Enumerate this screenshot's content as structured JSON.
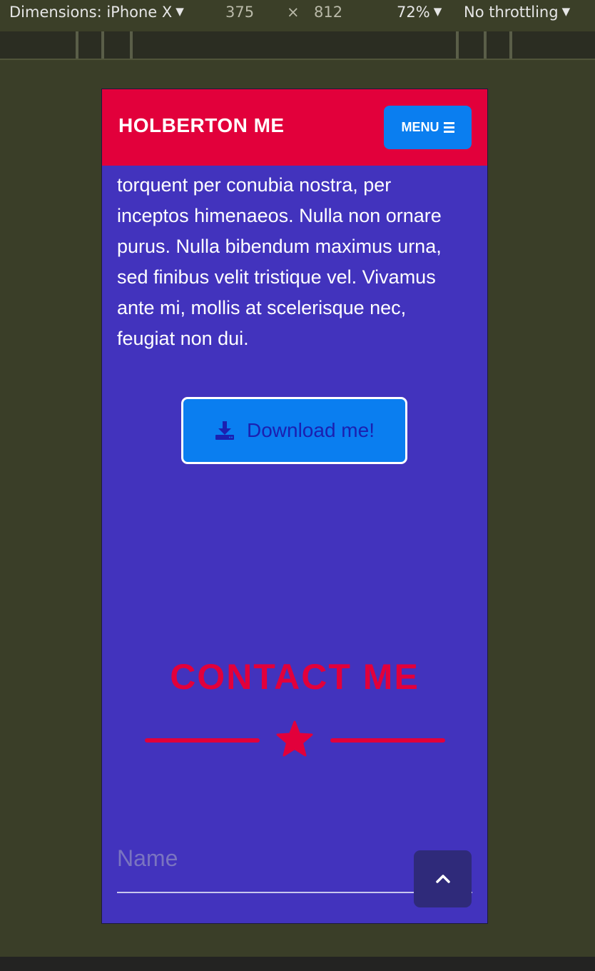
{
  "devtools": {
    "dimensions_label": "Dimensions: iPhone X",
    "width": "375",
    "times": "×",
    "height": "812",
    "zoom": "72%",
    "throttling": "No throttling"
  },
  "navbar": {
    "brand": "HOLBERTON ME",
    "menu_label": "MENU"
  },
  "content": {
    "paragraph": "torquent per conubia nostra, per inceptos himenaeos. Nulla non ornare purus. Nulla bibendum maximus urna, sed finibus velit tristique vel. Vivamus ante mi, mollis at scelerisque nec, feugiat non dui.",
    "download_label": "Download me!"
  },
  "contact": {
    "title": "CONTACT ME",
    "name_placeholder": "Name"
  },
  "colors": {
    "navbar": "#e2003b",
    "page": "#4233bd",
    "button": "#0a7ef0",
    "accent": "#e2003b"
  },
  "icons": {
    "download": "download-icon",
    "menu": "bars-icon",
    "star": "star-icon",
    "scroll_top": "chevron-up-icon"
  }
}
